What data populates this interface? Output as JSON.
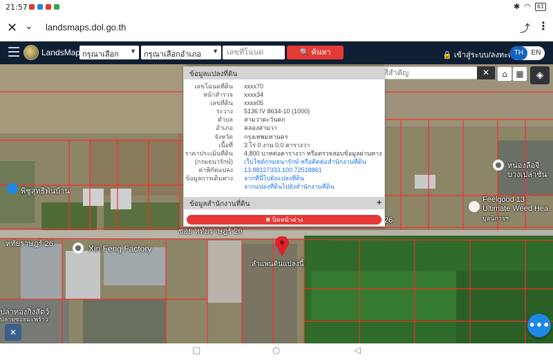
{
  "status": {
    "time": "21:57",
    "battery": "61"
  },
  "browser": {
    "url": "landsmaps.dol.go.th"
  },
  "header": {
    "brand": "LandsMaps",
    "province_select": "กรุณาเลือกจังหวัด",
    "district_select": "กรุณาเลือกอำเภอ",
    "deed_placeholder": "เลขที่โฉนด",
    "search_label": "ค้นหา",
    "login_label": "เข้าสู่ระบบ/ลงทะเบียน",
    "lang_th": "TH",
    "lang_en": "EN"
  },
  "map": {
    "search_placeholder": "ค้นหาสถานที่สำคัญ",
    "labels": {
      "road_left": "พิชูสุทธิพันบ้าน",
      "soi_label": "ซอย หทัยราษฎร์ 26",
      "soi_left": "หทัยราษฎร์ 26",
      "xin_feng": "Xin Feng Factory",
      "num_26": "26",
      "bottom_left": "ปล่าทองกิ่งสัตว์",
      "bottom_left2": "ปลายซอยมะพร้าว",
      "right_village": "หน่องลือจิ",
      "right_village2": "บางเปล่าชัน",
      "feelgood": "Feelgood 13 -",
      "ultimate": "Ultimate Weed Hea",
      "feelgood_sub": "บุลนิการฯ",
      "pin_label": "ลำแพนดินแปลงนี้"
    }
  },
  "panel": {
    "title": "ข้อมูลแปลงที่ดิน",
    "rows": [
      {
        "k": "เลขโฉนดที่ดิน",
        "v": "xxxx70"
      },
      {
        "k": "หน้าสำรวจ",
        "v": "xxxx34"
      },
      {
        "k": "เลขที่ดิน",
        "v": "xxxx05"
      },
      {
        "k": "ระวาง",
        "v": "5136 IV 8634-10 (1000)"
      },
      {
        "k": "ตำบล",
        "v": "สามวาตะวันตก"
      },
      {
        "k": "อำเภอ",
        "v": "คลองสามวา"
      },
      {
        "k": "จังหวัด",
        "v": "กรุงเทพมหานคร"
      },
      {
        "k": "เนื้อที่",
        "v": "3 ไร่ 0 งาน 0.0 ตารางวา"
      },
      {
        "k": "ราคาประเมินที่ดิน",
        "v": "4,800 บาทต่อตารางวา หรือตรวจสอบข้อมูลผ่านทาง"
      },
      {
        "k": "(กรมธนารักษ์)",
        "v": "เว็บไซต์กรมธนารักษ์ หรือติดต่อสำนักงานที่ดิน"
      },
      {
        "k": "ค่าพิกัดแปลง",
        "v": "13.88127333,100.72518861"
      },
      {
        "k": "ข้อมูลการเดินทาง",
        "v": "จากที่นี่ไปยังแปลงที่ดิน"
      },
      {
        "k": "",
        "v": "จากแปลงที่ดินไปยังสำนักงานที่ดิน"
      }
    ],
    "office_section": "ข้อมูลสำนักงานที่ดิน",
    "close_label": "✖ ปิดหน้าต่าง"
  }
}
